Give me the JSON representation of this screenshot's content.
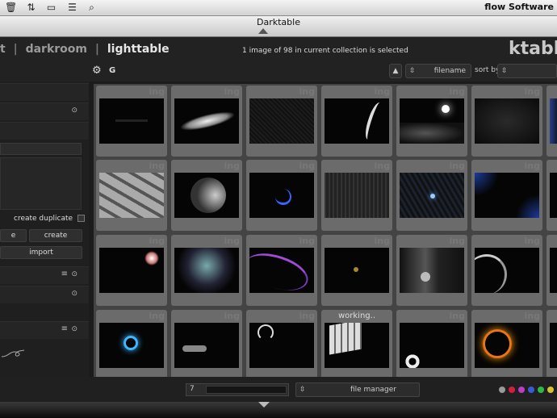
{
  "topbar": {
    "app_name": "flow Software"
  },
  "window": {
    "title": "Darktable"
  },
  "header": {
    "views": [
      "t",
      "darkroom",
      "lighttable"
    ],
    "separator": "|",
    "collection_message": "1 image of 98 in current collection is selected",
    "brand": "ktable",
    "star_key": "G"
  },
  "toolbar": {
    "sort_by_label": "sort by",
    "sort_value": "filename",
    "sort_dir": "▲"
  },
  "left_panel": {
    "create_duplicate": "create duplicate",
    "create_button": "create",
    "cut_button": "e",
    "import_button": "import"
  },
  "grid": {
    "watermark": "ing",
    "working_label": "working..",
    "thumbnails": [
      {
        "row": 0,
        "col": 0,
        "scene": "dark-text"
      },
      {
        "row": 0,
        "col": 1,
        "scene": "smoke"
      },
      {
        "row": 0,
        "col": 2,
        "scene": "texture"
      },
      {
        "row": 0,
        "col": 3,
        "scene": "swirl"
      },
      {
        "row": 0,
        "col": 4,
        "scene": "moon-clouds"
      },
      {
        "row": 0,
        "col": 5,
        "scene": "dark-gradient"
      },
      {
        "row": 0,
        "col": 6,
        "scene": "blue-edge"
      },
      {
        "row": 1,
        "col": 0,
        "scene": "cubes"
      },
      {
        "row": 1,
        "col": 1,
        "scene": "planet"
      },
      {
        "row": 1,
        "col": 2,
        "scene": "blue-arc"
      },
      {
        "row": 1,
        "col": 3,
        "scene": "gray-stripes"
      },
      {
        "row": 1,
        "col": 4,
        "scene": "blue-dot"
      },
      {
        "row": 1,
        "col": 5,
        "scene": "blue-corners"
      },
      {
        "row": 1,
        "col": 6,
        "scene": "dark"
      },
      {
        "row": 2,
        "col": 0,
        "scene": "flower"
      },
      {
        "row": 2,
        "col": 1,
        "scene": "teal-splash"
      },
      {
        "row": 2,
        "col": 2,
        "scene": "purple-ribbons"
      },
      {
        "row": 2,
        "col": 3,
        "scene": "gold-dot"
      },
      {
        "row": 2,
        "col": 4,
        "scene": "room"
      },
      {
        "row": 2,
        "col": 5,
        "scene": "gray-arc"
      },
      {
        "row": 2,
        "col": 6,
        "scene": "dark"
      },
      {
        "row": 3,
        "col": 0,
        "scene": "blue-ring"
      },
      {
        "row": 3,
        "col": 1,
        "scene": "car"
      },
      {
        "row": 3,
        "col": 2,
        "scene": "bird"
      },
      {
        "row": 3,
        "col": 3,
        "scene": "window",
        "working": true
      },
      {
        "row": 3,
        "col": 4,
        "scene": "gear"
      },
      {
        "row": 3,
        "col": 5,
        "scene": "fire-ring"
      },
      {
        "row": 3,
        "col": 6,
        "scene": "dark"
      }
    ]
  },
  "bottom": {
    "zoom_value": "7",
    "file_manager": "file manager",
    "color_labels": [
      "#9a9a9a",
      "#d21f3c",
      "#c03cc8",
      "#3c5ad8",
      "#2fb84a",
      "#d8c12e",
      "#e0213a"
    ]
  }
}
